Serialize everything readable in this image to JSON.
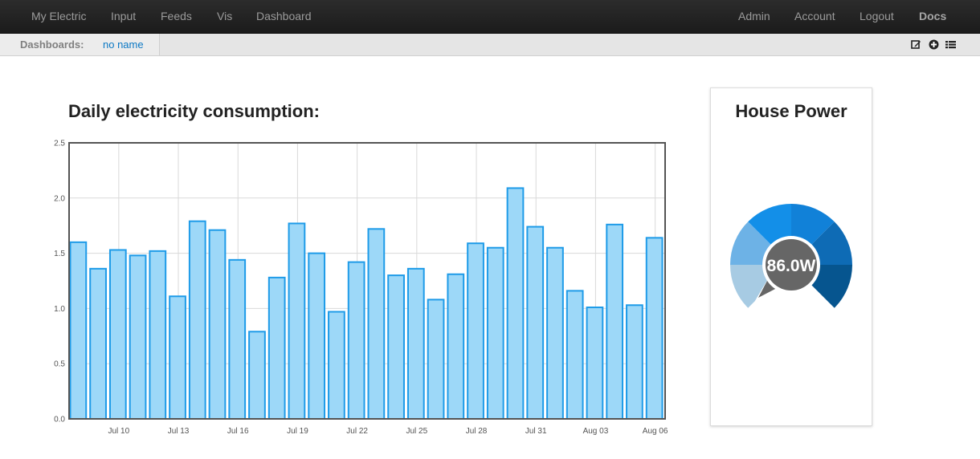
{
  "navbar": {
    "left": [
      "My Electric",
      "Input",
      "Feeds",
      "Vis",
      "Dashboard"
    ],
    "right": [
      "Admin",
      "Account",
      "Logout",
      "Docs"
    ]
  },
  "dashboards": {
    "label": "Dashboards:",
    "name": "no name",
    "icons": [
      "edit-icon",
      "add-circle-icon",
      "list-icon"
    ]
  },
  "chart_title": "Daily electricity consumption:",
  "chart_data": {
    "type": "bar",
    "ylim": [
      0,
      2.5
    ],
    "yticks": [
      "0.0",
      "0.5",
      "1.0",
      "1.5",
      "2.0",
      "2.5"
    ],
    "xticks": [
      "Jul 10",
      "Jul 13",
      "Jul 16",
      "Jul 19",
      "Jul 22",
      "Jul 25",
      "Jul 28",
      "Jul 31",
      "Aug 03",
      "Aug 06"
    ],
    "grid": true,
    "bar_color": "#9dd8f8",
    "bar_border": "#1e9be8",
    "dates": [
      "Jul 08",
      "Jul 09",
      "Jul 10",
      "Jul 11",
      "Jul 12",
      "Jul 13",
      "Jul 14",
      "Jul 15",
      "Jul 16",
      "Jul 17",
      "Jul 18",
      "Jul 19",
      "Jul 20",
      "Jul 21",
      "Jul 22",
      "Jul 23",
      "Jul 24",
      "Jul 25",
      "Jul 26",
      "Jul 27",
      "Jul 28",
      "Jul 29",
      "Jul 30",
      "Jul 31",
      "Aug 01",
      "Aug 02",
      "Aug 03",
      "Aug 04",
      "Aug 05",
      "Aug 06"
    ],
    "values": [
      1.6,
      1.36,
      1.53,
      1.48,
      1.52,
      1.11,
      1.79,
      1.71,
      1.44,
      0.79,
      1.28,
      1.77,
      1.5,
      0.97,
      1.42,
      1.72,
      1.3,
      1.36,
      1.08,
      1.31,
      1.59,
      1.55,
      2.09,
      1.74,
      1.55,
      1.16,
      1.01,
      1.76,
      1.03,
      1.64
    ]
  },
  "gauge": {
    "title": "House Power",
    "value_label": "86.0W",
    "needle_color": "#666666",
    "segment_colors": [
      "#a7cbe3",
      "#6db2e6",
      "#138fe8",
      "#1181d8",
      "#0e6bb5",
      "#06558f"
    ]
  }
}
